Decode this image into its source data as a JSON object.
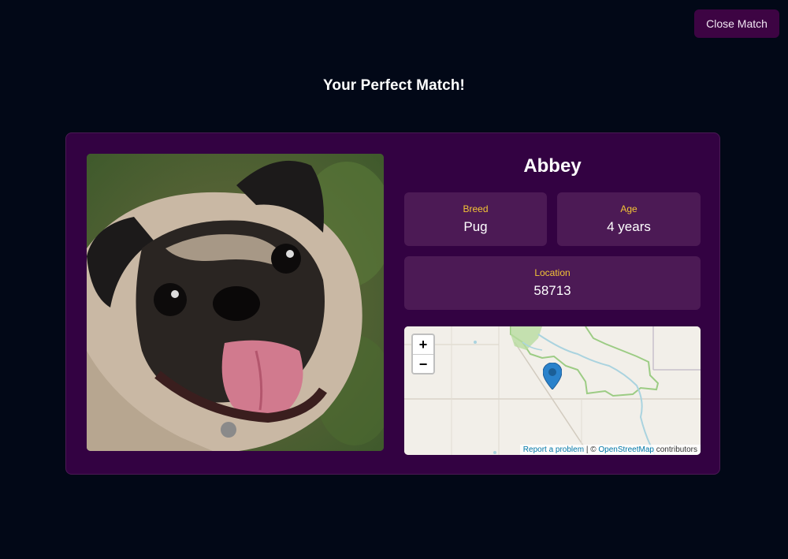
{
  "header": {
    "close_label": "Close Match"
  },
  "page": {
    "title": "Your Perfect Match!"
  },
  "pet": {
    "name": "Abbey",
    "breed_label": "Breed",
    "breed": "Pug",
    "age_label": "Age",
    "age": "4 years",
    "location_label": "Location",
    "location": "58713",
    "photo_alt": "pug"
  },
  "map": {
    "zoom_in": "+",
    "zoom_out": "−",
    "report_link": "Report a problem",
    "separator": " | © ",
    "osm_link": "OpenStreetMap",
    "contributors": " contributors",
    "marker_icon": "map-pin-icon"
  },
  "colors": {
    "background": "#020817",
    "card": "#330242",
    "info_box": "#4c1a55",
    "label": "#f4c436",
    "button": "#3d0443"
  }
}
